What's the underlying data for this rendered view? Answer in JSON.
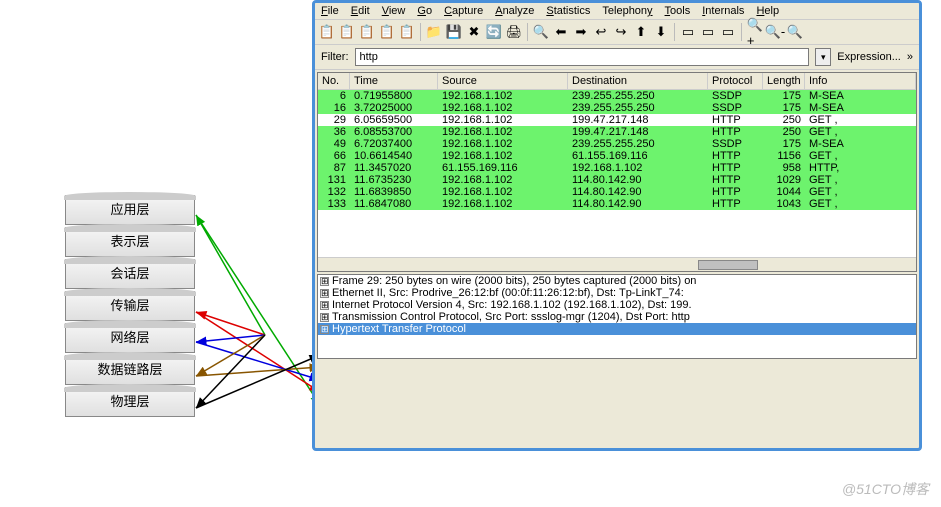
{
  "osi_layers": [
    "应用层",
    "表示层",
    "会话层",
    "传输层",
    "网络层",
    "数据链路层",
    "物理层"
  ],
  "menubar": [
    {
      "u": "F",
      "rest": "ile"
    },
    {
      "u": "E",
      "rest": "dit"
    },
    {
      "u": "V",
      "rest": "iew"
    },
    {
      "u": "G",
      "rest": "o"
    },
    {
      "u": "C",
      "rest": "apture"
    },
    {
      "u": "A",
      "rest": "nalyze"
    },
    {
      "u": "S",
      "rest": "tatistics"
    },
    {
      "u": "",
      "rest": "Telephon",
      "u2": "y"
    },
    {
      "u": "T",
      "rest": "ools"
    },
    {
      "u": "I",
      "rest": "nternals"
    },
    {
      "u": "H",
      "rest": "elp"
    }
  ],
  "toolbar_icons": [
    "📋",
    "📋",
    "📋",
    "📋",
    "📋",
    "|",
    "📁",
    "💾",
    "✖",
    "🔄",
    "🖨",
    "|",
    "🔍",
    "⬅",
    "➡",
    "↩",
    "↪",
    "⬆",
    "⬇",
    "|",
    "▭",
    "▭",
    "▭",
    "|",
    "🔍+",
    "🔍-",
    "🔍"
  ],
  "filter": {
    "label": "Filter:",
    "value": "http",
    "expr": "Expression...",
    "dd": "▾",
    "more": "»"
  },
  "packet_columns": [
    "No.",
    "Time",
    "Source",
    "Destination",
    "Protocol",
    "Length",
    "Info"
  ],
  "packets": [
    {
      "no": "6",
      "time": "0.71955800",
      "src": "192.168.1.102",
      "dst": "239.255.255.250",
      "proto": "SSDP",
      "len": "175",
      "info": "M-SEA",
      "cls": ""
    },
    {
      "no": "16",
      "time": "3.72025000",
      "src": "192.168.1.102",
      "dst": "239.255.255.250",
      "proto": "SSDP",
      "len": "175",
      "info": "M-SEA",
      "cls": ""
    },
    {
      "no": "29",
      "time": "6.05659500",
      "src": "192.168.1.102",
      "dst": "199.47.217.148",
      "proto": "HTTP",
      "len": "250",
      "info": "GET ,",
      "cls": "sel"
    },
    {
      "no": "36",
      "time": "6.08553700",
      "src": "192.168.1.102",
      "dst": "199.47.217.148",
      "proto": "HTTP",
      "len": "250",
      "info": "GET ,",
      "cls": ""
    },
    {
      "no": "49",
      "time": "6.72037400",
      "src": "192.168.1.102",
      "dst": "239.255.255.250",
      "proto": "SSDP",
      "len": "175",
      "info": "M-SEA",
      "cls": ""
    },
    {
      "no": "66",
      "time": "10.6614540",
      "src": "192.168.1.102",
      "dst": "61.155.169.116",
      "proto": "HTTP",
      "len": "1156",
      "info": "GET ,",
      "cls": ""
    },
    {
      "no": "87",
      "time": "11.3457020",
      "src": "61.155.169.116",
      "dst": "192.168.1.102",
      "proto": "HTTP",
      "len": "958",
      "info": "HTTP,",
      "cls": ""
    },
    {
      "no": "131",
      "time": "11.6735230",
      "src": "192.168.1.102",
      "dst": "114.80.142.90",
      "proto": "HTTP",
      "len": "1029",
      "info": "GET ,",
      "cls": ""
    },
    {
      "no": "132",
      "time": "11.6839850",
      "src": "192.168.1.102",
      "dst": "114.80.142.90",
      "proto": "HTTP",
      "len": "1044",
      "info": "GET ,",
      "cls": ""
    },
    {
      "no": "133",
      "time": "11.6847080",
      "src": "192.168.1.102",
      "dst": "114.80.142.90",
      "proto": "HTTP",
      "len": "1043",
      "info": "GET ,",
      "cls": ""
    }
  ],
  "details": [
    "Frame 29: 250 bytes on wire (2000 bits), 250 bytes captured (2000 bits) on",
    "Ethernet II, Src: Prodrive_26:12:bf (00:0f:11:26:12:bf), Dst: Tp-LinkT_74:",
    "Internet Protocol Version 4, Src: 192.168.1.102 (192.168.1.102), Dst: 199.",
    "Transmission Control Protocol, Src Port: ssslog-mgr (1204), Dst Port: http",
    "Hypertext Transfer Protocol"
  ],
  "expand_glyph": "⊞",
  "watermark": "@51CTO博客"
}
